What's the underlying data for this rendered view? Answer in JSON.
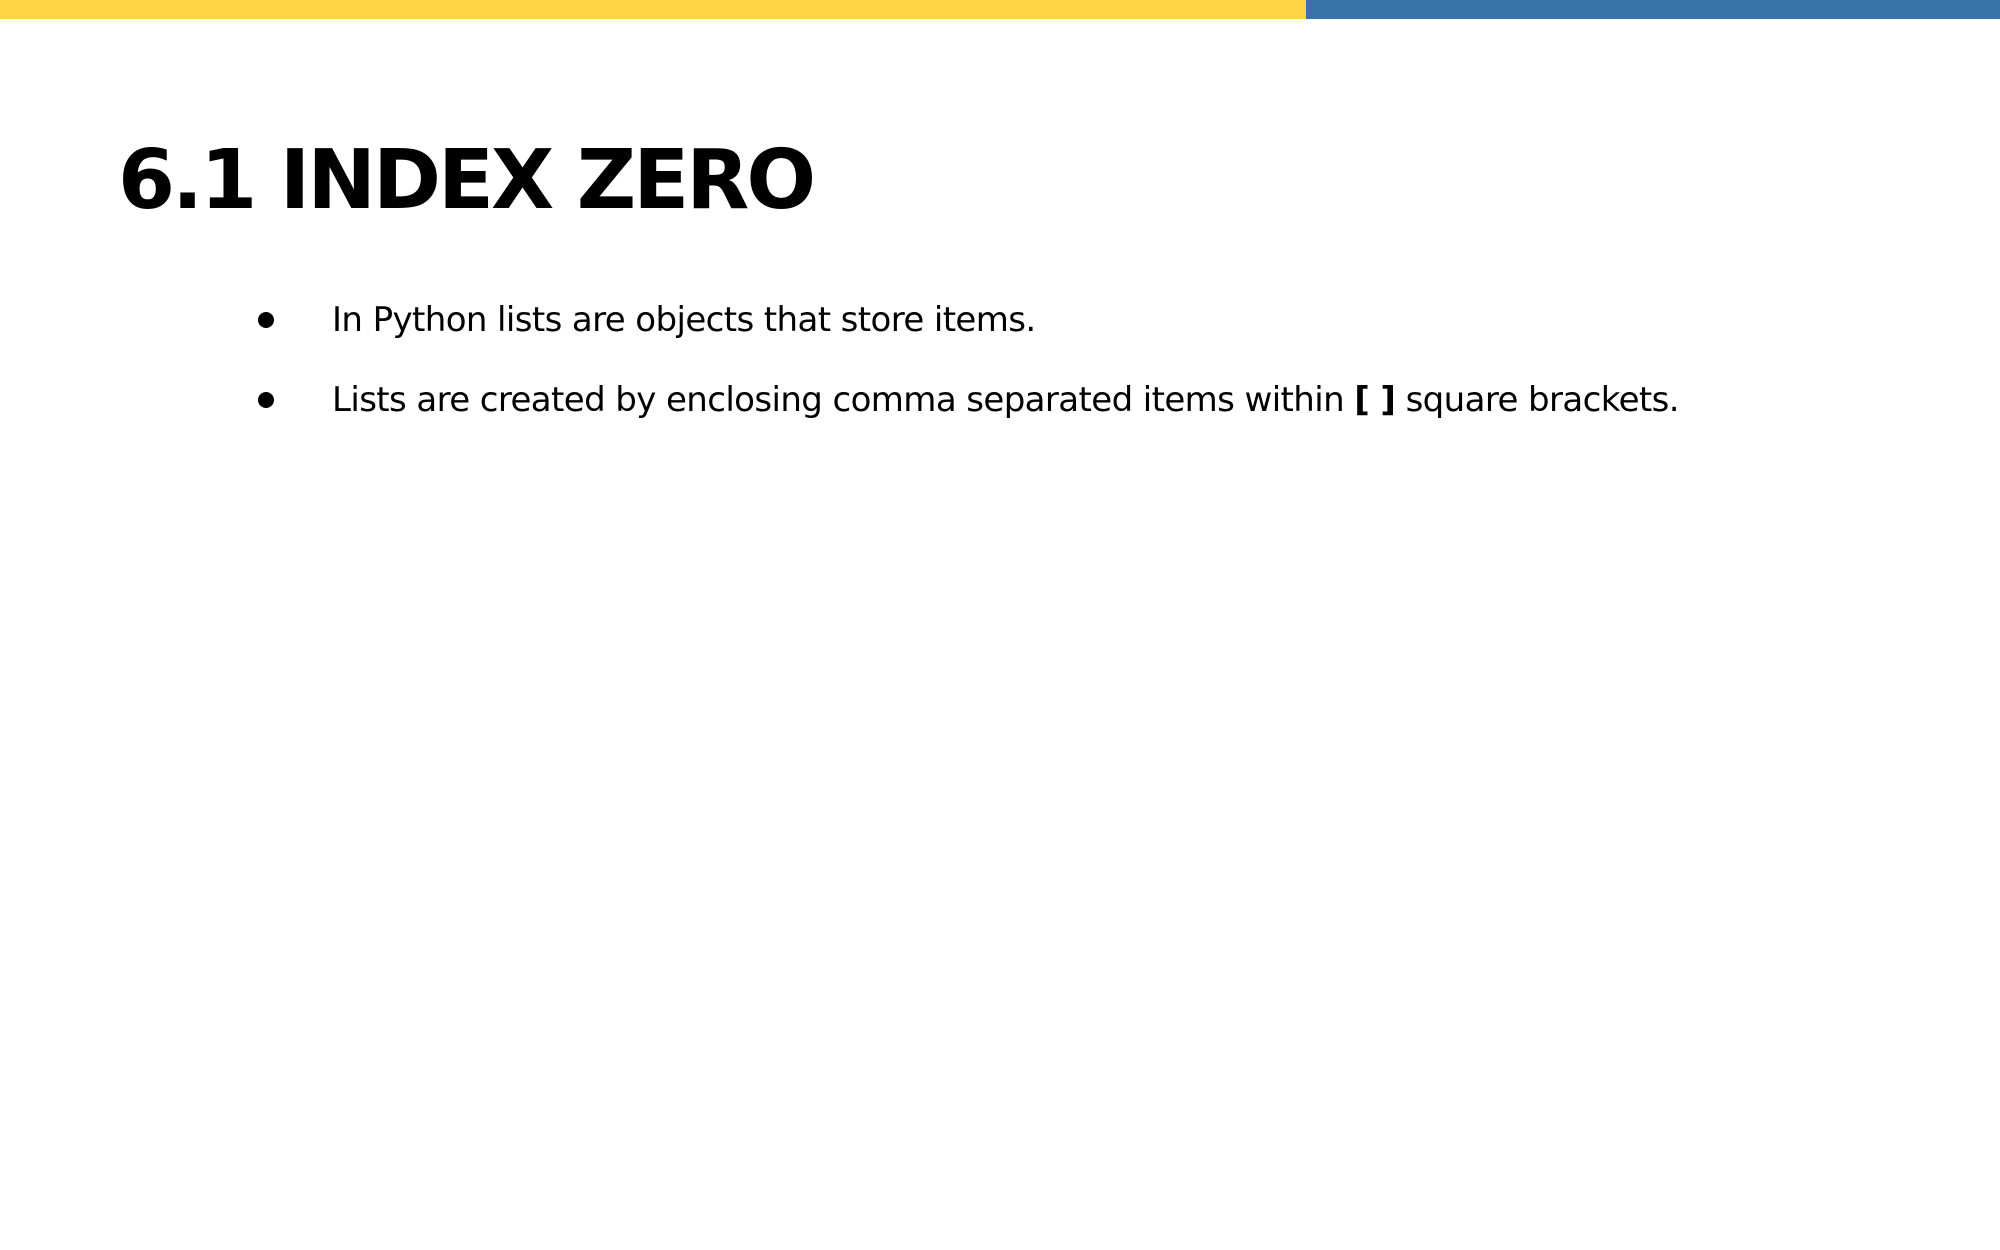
{
  "colors": {
    "bar_yellow": "#FFD343",
    "bar_blue": "#3874A8"
  },
  "slide": {
    "title": "6.1 INDEX ZERO",
    "bullets": [
      {
        "text": "In Python lists are objects that store items."
      },
      {
        "text_before": "Lists are created by enclosing comma separated items within ",
        "bold": "[ ]",
        "text_after": " square brackets."
      }
    ]
  }
}
